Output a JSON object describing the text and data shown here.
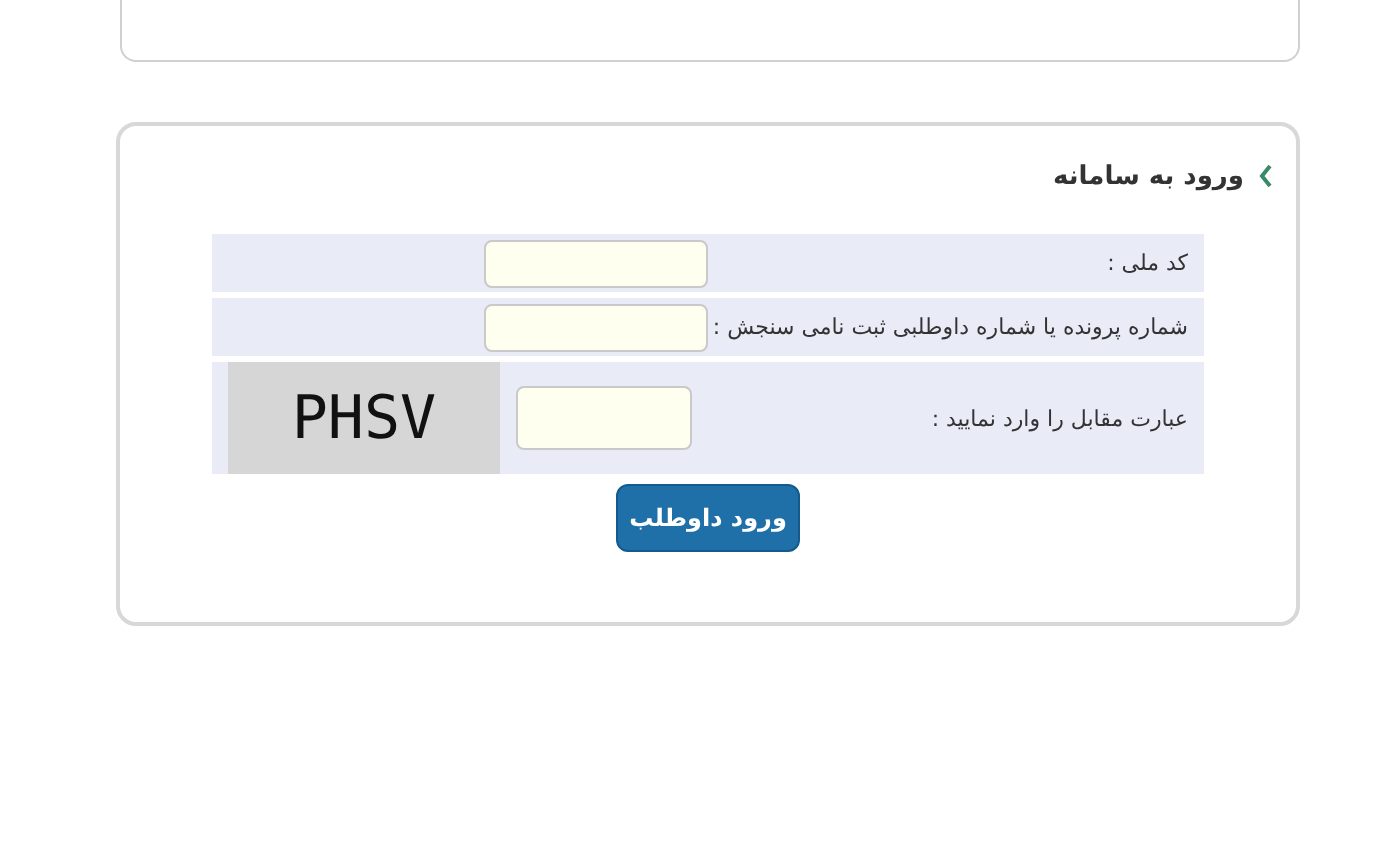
{
  "panel": {
    "title": "ورود به سامانه"
  },
  "form": {
    "rows": [
      {
        "kind": "text",
        "label": "کد ملی :"
      },
      {
        "kind": "text",
        "label": "شماره پرونده یا شماره داوطلبی ثبت نامی سنجش :"
      },
      {
        "kind": "captcha",
        "label": "عبارت مقابل را وارد نمایید :",
        "captcha": "PHSV"
      }
    ],
    "submit": "ورود داوطلب"
  }
}
